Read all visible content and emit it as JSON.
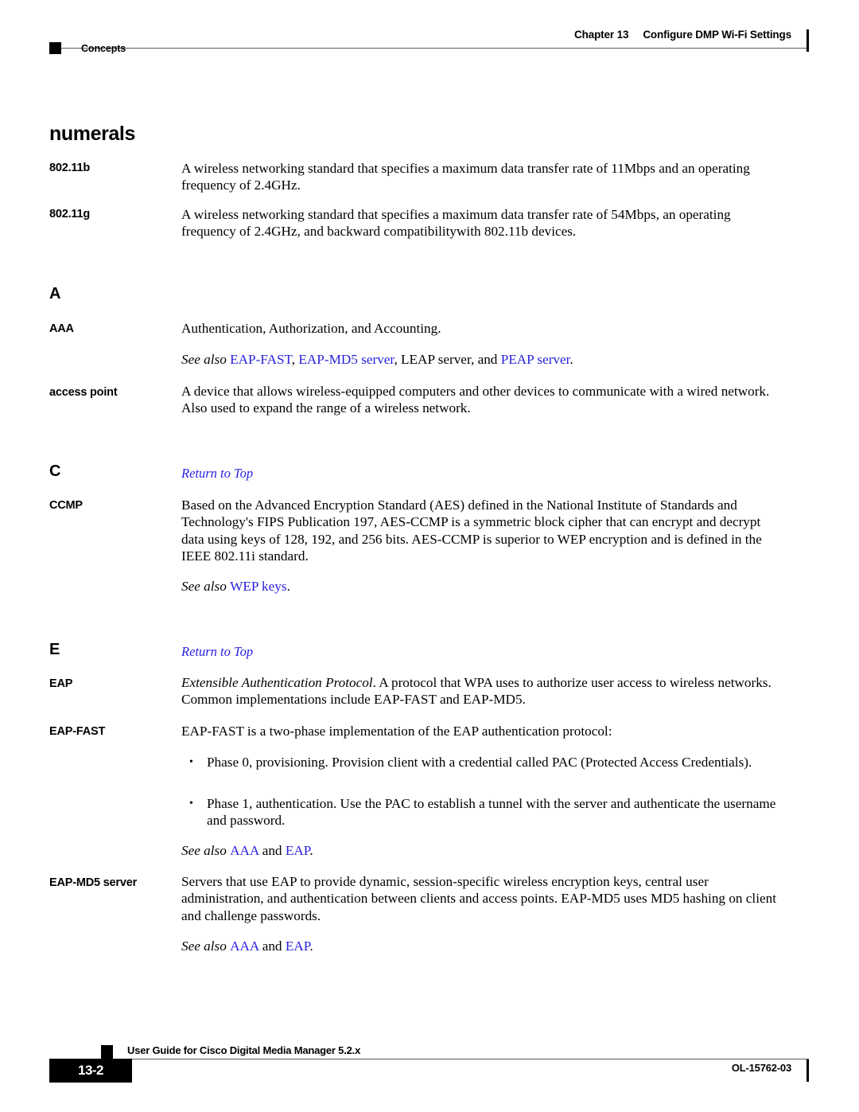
{
  "header": {
    "chapter": "Chapter 13",
    "chapter_title": "Configure DMP Wi-Fi Settings",
    "section_label": "Concepts"
  },
  "page": {
    "title": "numerals"
  },
  "links": {
    "return_to_top": "Return to Top"
  },
  "sections": [
    {
      "letter": "",
      "entries": [
        {
          "term": "802.11b",
          "definition": "A wireless networking standard that specifies a maximum data transfer rate of 11Mbps and an operating frequency of 2.4GHz."
        },
        {
          "term": "802.11g",
          "definition": "A wireless networking standard that specifies a maximum data transfer rate of 54Mbps, an operating frequency of 2.4GHz, and backward compatibilitywith 802.11b devices."
        }
      ]
    },
    {
      "letter": "A",
      "entries": [
        {
          "term": "AAA",
          "definition": "Authentication, Authorization, and Accounting.",
          "see_also": {
            "lead": "See also ",
            "parts": [
              {
                "text": "EAP-FAST",
                "link": true
              },
              {
                "text": ", ",
                "link": false
              },
              {
                "text": "EAP-MD5 server",
                "link": true
              },
              {
                "text": ", LEAP server, and ",
                "link": false
              },
              {
                "text": "PEAP server",
                "link": true
              },
              {
                "text": ".",
                "link": false
              }
            ]
          }
        },
        {
          "term": "access point",
          "definition": "A device that allows wireless-equipped computers and other devices to communicate with a wired network. Also used to expand the range of a wireless network."
        }
      ]
    },
    {
      "letter": "C",
      "entries": [
        {
          "term": "CCMP",
          "definition": "Based on the Advanced Encryption Standard (AES) defined in the National Institute of Standards and Technology's FIPS Publication 197, AES-CCMP is a symmetric block cipher that can encrypt and decrypt data using keys of 128, 192, and 256 bits. AES-CCMP is superior to WEP encryption and is defined in the IEEE 802.11i standard.",
          "see_also": {
            "lead": "See also ",
            "parts": [
              {
                "text": "WEP keys",
                "link": true
              },
              {
                "text": ".",
                "link": false
              }
            ]
          }
        }
      ]
    },
    {
      "letter": "E",
      "entries": [
        {
          "term": "EAP",
          "definition_italic_lead": "Extensible Authentication Protocol",
          "definition": ". A protocol that WPA uses to authorize user access to wireless networks. Common implementations include EAP-FAST and EAP-MD5."
        },
        {
          "term": "EAP-FAST",
          "definition": "EAP-FAST is a two-phase implementation of the EAP authentication protocol:",
          "bullets": [
            "Phase 0, provisioning. Provision client with a credential called PAC (Protected Access Credentials).",
            "Phase 1, authentication. Use the PAC to establish a tunnel with the server and authenticate the username and password."
          ],
          "see_also": {
            "lead": "See also ",
            "parts": [
              {
                "text": "AAA",
                "link": true
              },
              {
                "text": " and ",
                "link": false
              },
              {
                "text": "EAP",
                "link": true
              },
              {
                "text": ".",
                "link": false
              }
            ]
          }
        },
        {
          "term": "EAP-MD5 server",
          "definition": "Servers that use EAP to provide dynamic, session-specific wireless encryption keys, central user administration, and authentication between clients and access points. EAP-MD5 uses MD5 hashing on client and challenge passwords.",
          "see_also": {
            "lead": "See also ",
            "parts": [
              {
                "text": "AAA",
                "link": true
              },
              {
                "text": " and ",
                "link": false
              },
              {
                "text": "EAP",
                "link": true
              },
              {
                "text": ".",
                "link": false
              }
            ]
          }
        }
      ]
    }
  ],
  "footer": {
    "guide_title": "User Guide for Cisco Digital Media Manager 5.2.x",
    "page_number": "13-2",
    "doc_id": "OL-15762-03"
  },
  "colors": {
    "link_blue": "#2a22dd",
    "rule_gray": "#5b5b5b",
    "text_black": "#000000"
  }
}
